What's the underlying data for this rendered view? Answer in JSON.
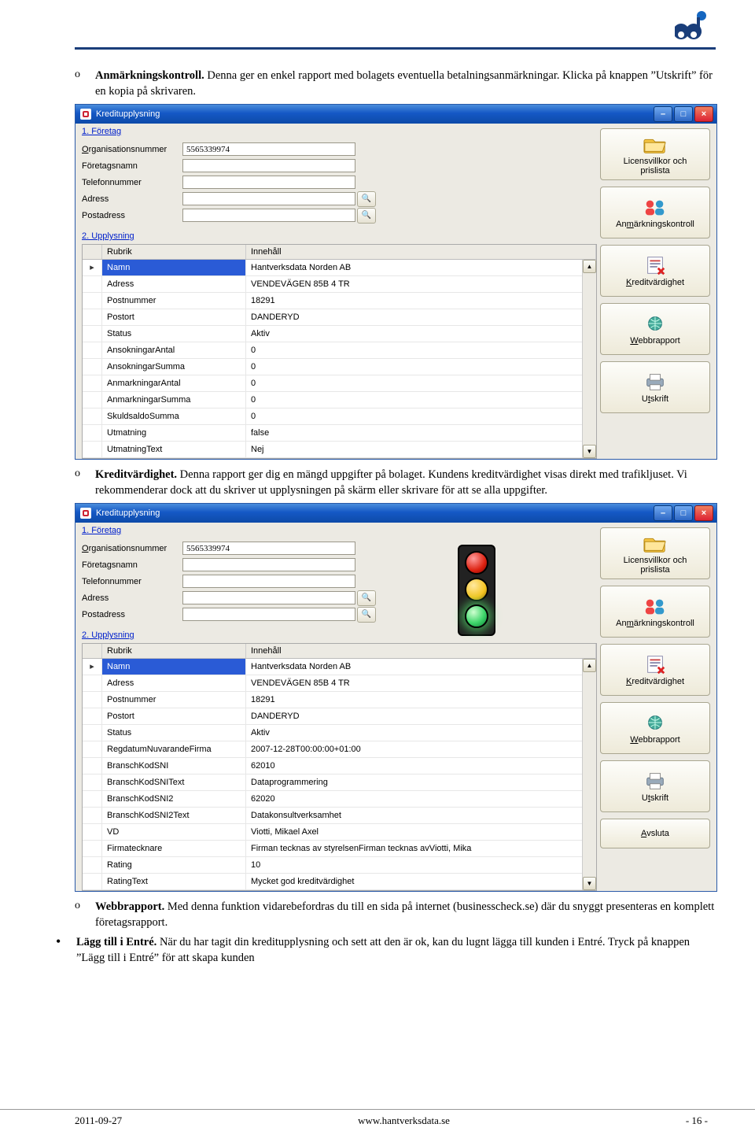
{
  "document": {
    "bullets": {
      "anm": {
        "marker": "o",
        "title": "Anmärkningskontroll.",
        "text": " Denna ger en enkel rapport med bolagets eventuella betalningsanmärkningar. Klicka på knappen ”Utskrift” för en kopia på skrivaren."
      },
      "kred": {
        "marker": "o",
        "title": "Kreditvärdighet.",
        "text": " Denna rapport ger dig en mängd uppgifter på bolaget. Kundens kreditvärdighet visas direkt med trafikljuset. Vi rekommenderar dock att du skriver ut upplysningen på skärm eller skrivare för att se alla uppgifter."
      },
      "webb": {
        "marker": "o",
        "title": "Webbrapport.",
        "text": " Med denna funktion vidarebefordras du till en sida på internet (businesscheck.se) där du snyggt presenteras en komplett företagsrapport."
      },
      "lagg": {
        "marker": "•",
        "title": "Lägg till i Entré.",
        "text": " När du har tagit din kreditupplysning och sett att den är ok, kan du lugnt lägga till kunden i Entré. Tryck på knappen ”Lägg till i Entré” för att skapa kunden"
      }
    },
    "footer": {
      "left": "2011-09-27",
      "center": "www.hantverksdata.se",
      "right": "- 16 -"
    }
  },
  "win1": {
    "title": "Kreditupplysning",
    "section1": "1. Företag",
    "section2": "2. Upplysning",
    "labels": {
      "org": "Organisationsnummer",
      "namn": "Företagsnamn",
      "tel": "Telefonnummer",
      "adr": "Adress",
      "post": "Postadress"
    },
    "values": {
      "org": "5565339974"
    },
    "gridHead": {
      "c1": "Rubrik",
      "c2": "Innehåll"
    },
    "rows": [
      {
        "c1": "Namn",
        "c2": "Hantverksdata Norden AB",
        "sel": true,
        "marker": "▸"
      },
      {
        "c1": "Adress",
        "c2": "VENDEVÄGEN 85B 4 TR"
      },
      {
        "c1": "Postnummer",
        "c2": "18291"
      },
      {
        "c1": "Postort",
        "c2": "DANDERYD"
      },
      {
        "c1": "Status",
        "c2": "Aktiv"
      },
      {
        "c1": "AnsokningarAntal",
        "c2": "0"
      },
      {
        "c1": "AnsokningarSumma",
        "c2": "0"
      },
      {
        "c1": "AnmarkningarAntal",
        "c2": "0"
      },
      {
        "c1": "AnmarkningarSumma",
        "c2": "0"
      },
      {
        "c1": "SkuldsaldoSumma",
        "c2": "0"
      },
      {
        "c1": "Utmatning",
        "c2": "false"
      },
      {
        "c1": "UtmatningText",
        "c2": "Nej"
      }
    ],
    "buttons": {
      "licens": "Licensvillkor och\nprislista",
      "anm": "Anmärkningskontroll",
      "kred": "Kreditvärdighet",
      "webb": "Webbrapport",
      "utskr": "Utskrift"
    }
  },
  "win2": {
    "title": "Kreditupplysning",
    "section1": "1. Företag",
    "section2": "2. Upplysning",
    "labels": {
      "org": "Organisationsnummer",
      "namn": "Företagsnamn",
      "tel": "Telefonnummer",
      "adr": "Adress",
      "post": "Postadress"
    },
    "values": {
      "org": "5565339974"
    },
    "gridHead": {
      "c1": "Rubrik",
      "c2": "Innehåll"
    },
    "rows": [
      {
        "c1": "Namn",
        "c2": "Hantverksdata Norden AB",
        "sel": true,
        "marker": "▸"
      },
      {
        "c1": "Adress",
        "c2": "VENDEVÄGEN 85B 4 TR"
      },
      {
        "c1": "Postnummer",
        "c2": "18291"
      },
      {
        "c1": "Postort",
        "c2": "DANDERYD"
      },
      {
        "c1": "Status",
        "c2": "Aktiv"
      },
      {
        "c1": "RegdatumNuvarandeFirma",
        "c2": "2007-12-28T00:00:00+01:00"
      },
      {
        "c1": "BranschKodSNI",
        "c2": "62010"
      },
      {
        "c1": "BranschKodSNIText",
        "c2": "Dataprogrammering"
      },
      {
        "c1": "BranschKodSNI2",
        "c2": "62020"
      },
      {
        "c1": "BranschKodSNI2Text",
        "c2": "Datakonsultverksamhet"
      },
      {
        "c1": "VD",
        "c2": "Viotti, Mikael Axel"
      },
      {
        "c1": "Firmatecknare",
        "c2": "Firman tecknas av styrelsenFirman tecknas avViotti, Mika"
      },
      {
        "c1": "Rating",
        "c2": "10"
      },
      {
        "c1": "RatingText",
        "c2": "Mycket god kreditvärdighet"
      }
    ],
    "buttons": {
      "licens": "Licensvillkor och\nprislista",
      "anm": "Anmärkningskontroll",
      "kred": "Kreditvärdighet",
      "webb": "Webbrapport",
      "utskr": "Utskrift",
      "avsl": "Avsluta"
    }
  }
}
